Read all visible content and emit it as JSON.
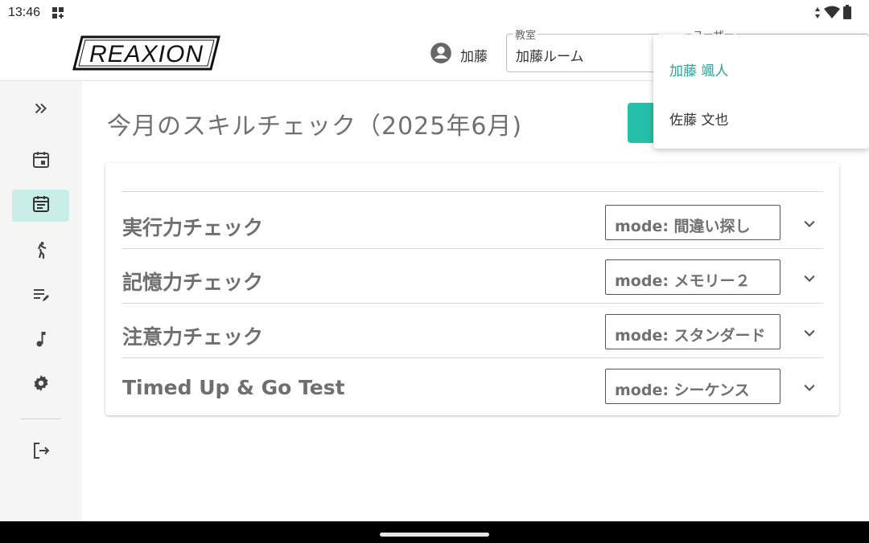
{
  "status_bar": {
    "time": "13:46",
    "icons": [
      "qs-grid-icon",
      "data-arrows-icon",
      "wifi-icon",
      "battery-icon"
    ]
  },
  "header": {
    "logo_text": "REAXION",
    "user_icon": "account-circle-icon",
    "user_name": "加藤",
    "classroom": {
      "label": "教室",
      "value": "加藤ルーム"
    },
    "user_select": {
      "label": "ユーザー"
    }
  },
  "dropdown": {
    "options": [
      {
        "label": "加藤 颯人",
        "selected": true
      },
      {
        "label": "佐藤 文也",
        "selected": false
      }
    ],
    "selected_color": "#26a69a"
  },
  "sidebar": {
    "items": [
      {
        "icon": "double-chevron-right-icon",
        "active": false
      },
      {
        "icon": "calendar-icon",
        "active": false
      },
      {
        "icon": "event-note-icon",
        "active": true
      },
      {
        "icon": "walking-icon",
        "active": false
      },
      {
        "icon": "edit-list-icon",
        "active": false
      },
      {
        "icon": "music-note-icon",
        "active": false
      },
      {
        "icon": "gear-icon",
        "active": false
      },
      {
        "icon": "logout-icon",
        "active": false
      }
    ],
    "active_bg": "#c8ece6"
  },
  "main": {
    "title": "今月のスキルチェック（2025年6月)",
    "accent": "#26bfaa",
    "checks": [
      {
        "title": "実行力チェック",
        "mode": "mode: 間違い探し"
      },
      {
        "title": "記憶力チェック",
        "mode": "mode: メモリー２"
      },
      {
        "title": "注意力チェック",
        "mode": "mode: スタンダード"
      },
      {
        "title": "Timed Up & Go Test",
        "mode": "mode: シーケンス"
      }
    ]
  }
}
